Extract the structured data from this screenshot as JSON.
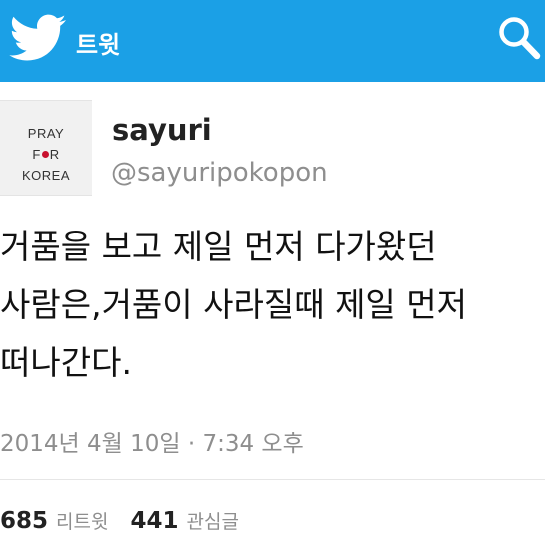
{
  "header": {
    "title": "트윗",
    "bird_icon": "twitter-bird-icon",
    "search_icon": "search-icon",
    "bg_color": "#1ba0e6"
  },
  "tweet": {
    "avatar": {
      "line1": "PRAY",
      "line2_left": "F",
      "line2_right": "R",
      "line3": "KOREA"
    },
    "name": "sayuri",
    "handle": "@sayuripokopon",
    "text": "거품을 보고 제일 먼저 다가왔던\n사람은,거품이 사라질때 제일 먼저\n떠나간다.",
    "timestamp": "2014년 4월 10일 · 7:34 오후"
  },
  "stats": {
    "retweets_count": "685",
    "retweets_label": "리트윗",
    "favorites_count": "441",
    "favorites_label": "관심글"
  }
}
